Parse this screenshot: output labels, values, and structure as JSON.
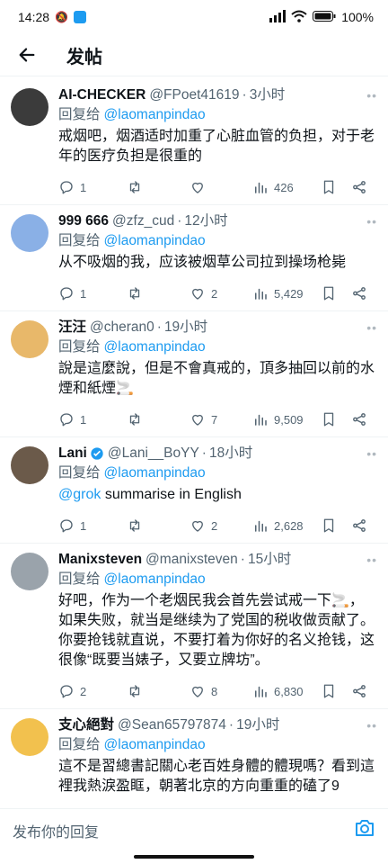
{
  "status": {
    "time": "14:28",
    "battery": "100%"
  },
  "header": {
    "title": "发帖"
  },
  "reply_prefix": "回复给",
  "tweets": [
    {
      "name": "AI-CHECKER",
      "handle": "@FPoet41619",
      "time": "3小时",
      "reply_to": "@laomanpindao",
      "text": "戒烟吧，烟酒适时加重了心脏血管的负担，对于老年的医疗负担是很重的",
      "replies": "1",
      "retweets": "",
      "likes": "",
      "views": "426",
      "avatar_color": "#3b3b3b"
    },
    {
      "name": "999 666",
      "handle": "@zfz_cud",
      "time": "12小时",
      "reply_to": "@laomanpindao",
      "text": "从不吸烟的我，应该被烟草公司拉到操场枪毙",
      "replies": "1",
      "retweets": "",
      "likes": "2",
      "views": "5,429",
      "avatar_color": "#8ab0e6"
    },
    {
      "name": "汪汪",
      "handle": "@cheran0",
      "time": "19小时",
      "reply_to": "@laomanpindao",
      "text": "說是這麼說，但是不會真戒的，頂多抽回以前的水煙和紙煙🚬",
      "replies": "1",
      "retweets": "",
      "likes": "7",
      "views": "9,509",
      "avatar_color": "#e8b86a"
    },
    {
      "name": "Lani",
      "handle": "@Lani__BoYY",
      "time": "18小时",
      "reply_to": "@laomanpindao",
      "mention": "@grok",
      "text": " summarise in English",
      "replies": "1",
      "retweets": "",
      "likes": "2",
      "views": "2,628",
      "avatar_color": "#6b5a4a",
      "verified": true
    },
    {
      "name": "Manixsteven",
      "handle": "@manixsteven",
      "time": "15小时",
      "reply_to": "@laomanpindao",
      "text": "好吧，作为一个老烟民我会首先尝试戒一下🚬，如果失败，就当是继续为了党国的税收做贡献了。你要抢钱就直说，不要打着为你好的名义抢钱，这很像“既要当婊子，又要立牌坊”。",
      "replies": "2",
      "retweets": "",
      "likes": "8",
      "views": "6,830",
      "avatar_color": "#9aa3ab"
    },
    {
      "name": "支心絕對",
      "handle": "@Sean65797874",
      "time": "19小时",
      "reply_to": "@laomanpindao",
      "text": "這不是習總書記關心老百姓身體的體現嗎？看到這裡我熱淚盈眶，朝著北京的方向重重的磕了9",
      "replies": "",
      "retweets": "",
      "likes": "",
      "views": "",
      "avatar_color": "#f2c14e"
    }
  ],
  "composer": {
    "placeholder": "发布你的回复"
  }
}
